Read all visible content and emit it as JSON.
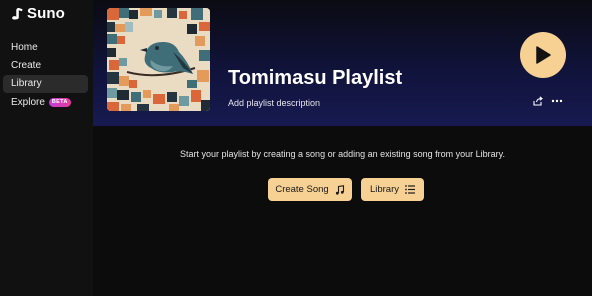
{
  "app": {
    "name": "Suno"
  },
  "sidebar": {
    "items": [
      {
        "label": "Home"
      },
      {
        "label": "Create"
      },
      {
        "label": "Library",
        "active": true
      },
      {
        "label": "Explore",
        "badge": "BETA"
      }
    ]
  },
  "playlist": {
    "title": "Tomimasu Playlist",
    "description_placeholder": "Add playlist description"
  },
  "empty_state": {
    "message": "Start your playlist by creating a song or adding an existing song from your Library.",
    "create_button": "Create Song",
    "library_button": "Library"
  },
  "colors": {
    "accent": "#f7d193",
    "hero_gradient_end": "#171a50",
    "beta_badge": "#d43cb8"
  },
  "icons": {
    "logo": "suno-note-icon",
    "play": "play-icon",
    "share": "share-icon",
    "more": "more-horizontal-icon",
    "music_note": "music-note-icon",
    "list": "list-icon"
  }
}
